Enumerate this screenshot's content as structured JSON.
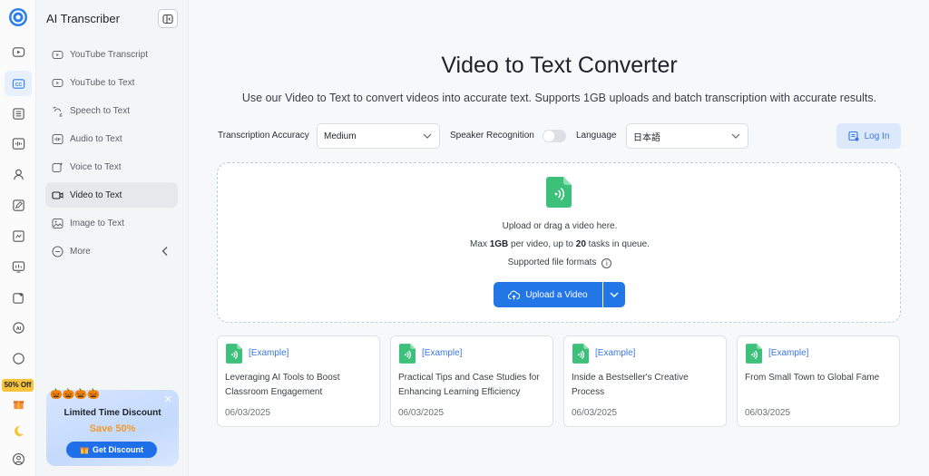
{
  "app": {
    "name": "AI Transcriber"
  },
  "rail": {
    "promo_tag": "50% Off"
  },
  "menu": {
    "items": [
      {
        "label": "YouTube Transcript"
      },
      {
        "label": "YouTube to Text"
      },
      {
        "label": "Speech to Text"
      },
      {
        "label": "Audio to Text"
      },
      {
        "label": "Voice to Text"
      },
      {
        "label": "Video to Text",
        "active": true
      },
      {
        "label": "Image to Text"
      },
      {
        "label": "More"
      }
    ]
  },
  "promo": {
    "title": "Limited Time Discount",
    "save": "Save 50%",
    "button": "Get Discount"
  },
  "main": {
    "title": "Video to Text Converter",
    "subtitle": "Use our Video to Text to convert videos into accurate text. Supports 1GB uploads and batch transcription with accurate results."
  },
  "options": {
    "accuracy_label": "Transcription Accuracy",
    "accuracy_value": "Medium",
    "speaker_label": "Speaker Recognition",
    "speaker_enabled": false,
    "language_label": "Language",
    "language_value": "日本語",
    "login": "Log In"
  },
  "upload": {
    "prompt": "Upload or drag a video here.",
    "limit_prefix": "Max ",
    "limit_size": "1GB",
    "limit_mid": " per video, up to ",
    "limit_tasks": "20",
    "limit_suffix": " tasks in queue.",
    "formats": "Supported file formats",
    "button": "Upload a Video"
  },
  "examples": [
    {
      "tag": "[Example]",
      "title": "Leveraging AI Tools to Boost Classroom Engagement",
      "date": "06/03/2025"
    },
    {
      "tag": "[Example]",
      "title": "Practical Tips and Case Studies for Enhancing Learning Efficiency",
      "date": "06/03/2025"
    },
    {
      "tag": "[Example]",
      "title": "Inside a Bestseller's Creative Process",
      "date": "06/03/2025"
    },
    {
      "tag": "[Example]",
      "title": "From Small Town to Global Fame",
      "date": "06/03/2025"
    }
  ],
  "colors": {
    "accent": "#2376e5",
    "file_icon": "#3cc07a",
    "promo_save": "#f19a2a"
  }
}
